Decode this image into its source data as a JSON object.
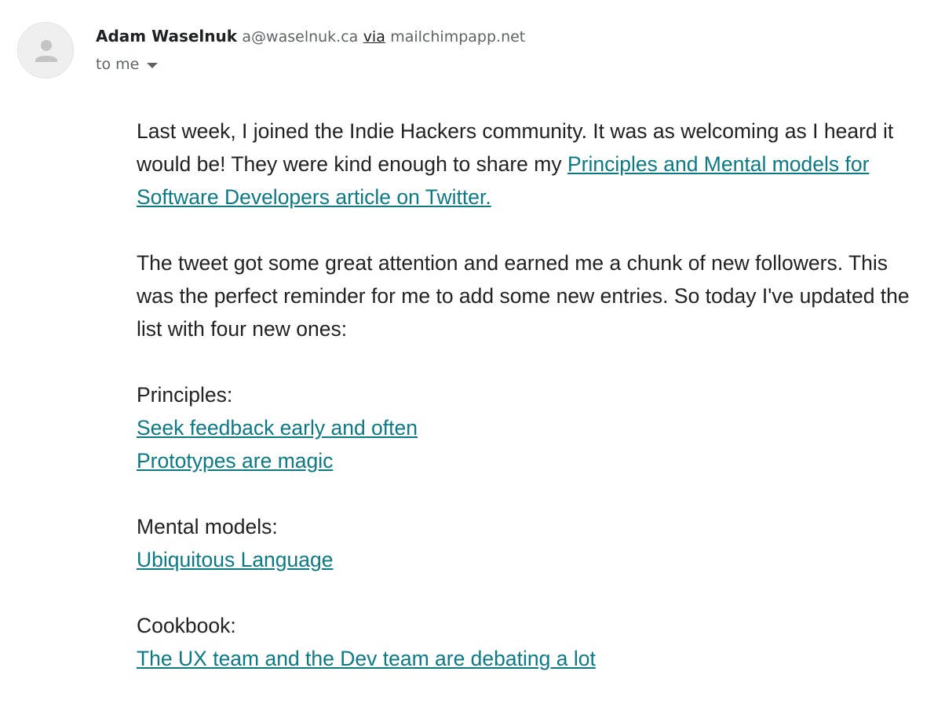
{
  "sender": {
    "name": "Adam Waselnuk",
    "email": "a@waselnuk.ca",
    "via_label": "via",
    "via_domain": "mailchimpapp.net",
    "recipient": "to me",
    "avatar_icon": "person-icon",
    "dropdown_icon": "caret-down-icon"
  },
  "body": {
    "paragraph1_text": "Last week, I joined the Indie Hackers community. It was as welcoming as I heard it would be! They were kind enough to share my ",
    "paragraph1_link": "Principles and Mental models for Software Developers article on Twitter.",
    "paragraph2": "The tweet got some great attention and earned me a chunk of new followers. This was the perfect reminder for me to add some new entries. So today I've updated the list with four new ones:",
    "sections": [
      {
        "heading": "Principles:",
        "links": [
          "Seek feedback early and often",
          "Prototypes are magic"
        ]
      },
      {
        "heading": "Mental models:",
        "links": [
          "Ubiquitous Language"
        ]
      },
      {
        "heading": "Cookbook:",
        "links": [
          "The UX team and the Dev team are debating a lot"
        ]
      }
    ]
  },
  "colors": {
    "link": "#0b7a84",
    "text": "#222222",
    "meta": "#5f6368"
  }
}
